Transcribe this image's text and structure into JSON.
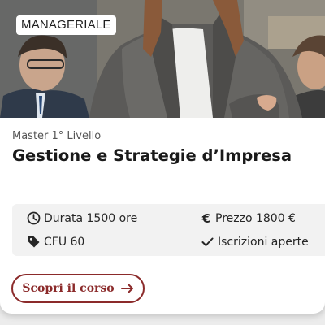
{
  "card": {
    "category_badge": "MANAGERIALE",
    "level": "Master 1° Livello",
    "title": "Gestione e Strategie d’Impresa",
    "details": {
      "duration": {
        "label": "Durata 1500 ore",
        "icon": "clock-icon"
      },
      "price": {
        "label": "Prezzo 1800 €",
        "icon": "euro-icon"
      },
      "credits": {
        "label": "CFU 60",
        "icon": "tag-icon"
      },
      "enrollment": {
        "label": "Iscrizioni aperte",
        "icon": "check-icon"
      }
    },
    "cta": {
      "label": "Scopri il corso",
      "icon": "arrow-right-icon"
    }
  },
  "colors": {
    "accent": "#8b2a2a",
    "info_background": "#f2f2f2",
    "title_text": "#1a1a1a"
  }
}
